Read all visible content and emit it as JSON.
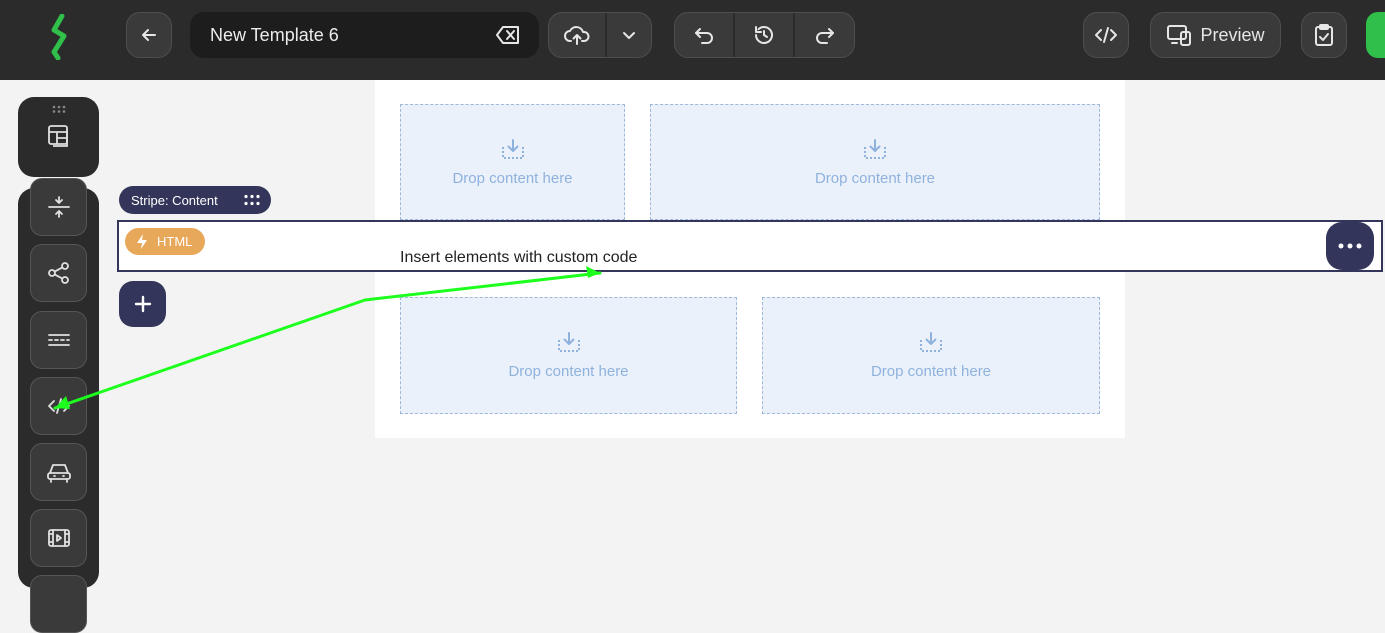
{
  "header": {
    "template_name": "New Template 6",
    "preview_label": "Preview"
  },
  "icons": {
    "logo": "lightning-logo-icon",
    "back": "arrow-left-icon",
    "clear": "backspace-icon",
    "upload": "cloud-upload-icon",
    "dropdown": "chevron-down-icon",
    "undo": "undo-icon",
    "history": "history-icon",
    "redo": "redo-icon",
    "code": "code-icon",
    "devices": "devices-icon",
    "clipboard": "clipboard-check-icon"
  },
  "sidebar": {
    "items": [
      "layout-icon",
      "spacer-icon",
      "share-icon",
      "divider-icon",
      "code-icon",
      "car-icon",
      "video-icon"
    ]
  },
  "canvas": {
    "drop_label_1": "Drop content here",
    "drop_label_2": "Drop content here",
    "drop_label_3": "Drop content here",
    "drop_label_4": "Drop content here"
  },
  "stripe": {
    "tag_label": "Stripe: Content"
  },
  "html_block": {
    "tag_label": "HTML",
    "content_text": "Insert elements with custom code"
  },
  "colors": {
    "accent": "#33365a",
    "html_tag": "#e8a85a",
    "annotation_arrow": "#1dff1d",
    "brand_green": "#2fbf4a"
  }
}
